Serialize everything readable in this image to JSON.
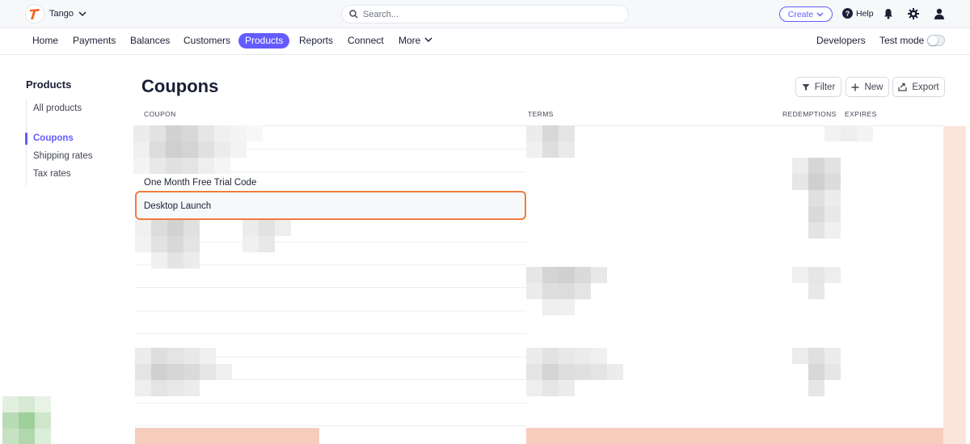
{
  "app": {
    "account_name": "Tango"
  },
  "search": {
    "placeholder": "Search..."
  },
  "topbar": {
    "create_label": "Create",
    "help_label": "Help"
  },
  "nav": {
    "items": [
      "Home",
      "Payments",
      "Balances",
      "Customers",
      "Products",
      "Reports",
      "Connect",
      "More"
    ],
    "active": "Products",
    "developers_label": "Developers",
    "test_mode_label": "Test mode",
    "test_mode_enabled": false
  },
  "sidebar": {
    "title": "Products",
    "items": [
      "All products",
      "Coupons",
      "Shipping rates",
      "Tax rates"
    ],
    "active": "Coupons"
  },
  "main": {
    "title": "Coupons",
    "toolbar": {
      "filter_label": "Filter",
      "new_label": "New",
      "export_label": "Export"
    },
    "columns": [
      "COUPON",
      "TERMS",
      "REDEMPTIONS",
      "EXPIRES"
    ],
    "rows": [
      {
        "name": "One Month Free Trial Code"
      },
      {
        "name": "Desktop Launch",
        "highlighted": true
      }
    ]
  },
  "colors": {
    "accent": "#635bff",
    "highlight_border": "#f07c3e",
    "brand_logo": "#f26522"
  }
}
